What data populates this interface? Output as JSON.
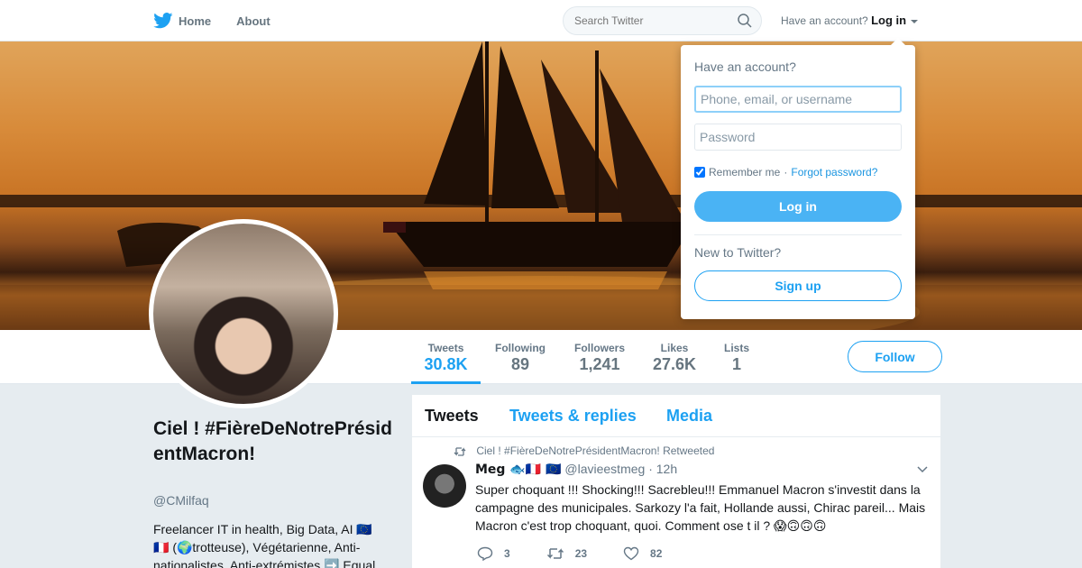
{
  "nav": {
    "home_label": "Home",
    "about_label": "About",
    "search_placeholder": "Search Twitter",
    "account_prompt": "Have an account?",
    "login_label": "Log in"
  },
  "profile": {
    "name": "Ciel ! #FièreDeNotrePrésidentMacron!",
    "handle": "@CMilfaq",
    "bio": "Freelancer IT in health, Big Data, AI 🇪🇺 🇫🇷 (🌍trotteuse), Végétarienne, Anti-nationalistes, Anti-extrémistes ➡️ Equal"
  },
  "stats": [
    {
      "label": "Tweets",
      "value": "30.8K"
    },
    {
      "label": "Following",
      "value": "89"
    },
    {
      "label": "Followers",
      "value": "1,241"
    },
    {
      "label": "Likes",
      "value": "27.6K"
    },
    {
      "label": "Lists",
      "value": "1"
    }
  ],
  "follow_label": "Follow",
  "timeline": {
    "tabs": [
      "Tweets",
      "Tweets & replies",
      "Media"
    ],
    "tweet": {
      "retweet_context": "Ciel ! #FièreDeNotrePrésidentMacron! Retweeted",
      "fullname": "Meg 🐟🇫🇷 🇪🇺",
      "handle": "@lavieestmeg",
      "time": "· 12h",
      "text": "Super choquant !!! Shocking!!! Sacrebleu!!! Emmanuel Macron s'investit dans la campagne des municipales. Sarkozy l'a fait, Hollande aussi, Chirac pareil... Mais Macron c'est trop choquant, quoi. Comment ose t il ? 😱🙃🙃🙃",
      "replies": "3",
      "retweets": "23",
      "likes": "82"
    }
  },
  "login_dropdown": {
    "title": "Have an account?",
    "username_placeholder": "Phone, email, or username",
    "password_placeholder": "Password",
    "remember_label": "Remember me",
    "separator": "·",
    "forgot_label": "Forgot password?",
    "login_button": "Log in",
    "new_prompt": "New to Twitter?",
    "signup_button": "Sign up"
  },
  "colors": {
    "accent": "#1da1f2",
    "login_button": "#4ab3f4",
    "background": "#e6ecf0"
  }
}
